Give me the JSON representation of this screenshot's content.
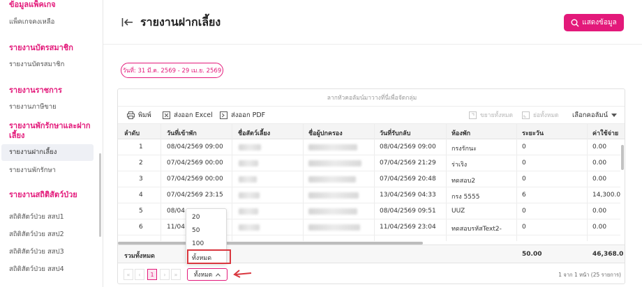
{
  "sidebar": {
    "sections": [
      {
        "title": "ข้อมูลแพ็คเกจ",
        "items": [
          "แพ็คเกจคงเหลือ"
        ]
      },
      {
        "title": "รายงานบัตรสมาชิก",
        "items": [
          "รายงานบัตรสมาชิก"
        ]
      },
      {
        "title": "รายงานราชการ",
        "items": [
          "รายงานภาษีขาย"
        ]
      },
      {
        "title": "รายงานพักรักษาและฝากเลี้ยง",
        "items": [
          "รายงานฝากเลี้ยง",
          "รายงานพักรักษา"
        ]
      },
      {
        "title": "รายงานสถิติสัตว์ป่วย",
        "items": [
          "สถิติสัตว์ป่วย สสป1",
          "สถิติสัตว์ป่วย สสป2",
          "สถิติสัตว์ป่วย สสป3",
          "สถิติสัตว์ป่วย สสป4"
        ]
      }
    ]
  },
  "header": {
    "title": "รายงานฝากเลี้ยง",
    "show_button": "แสดงข้อมูล"
  },
  "filter": {
    "date_range": "วันที่: 31 มี.ค. 2569 - 29 เม.ย. 2569"
  },
  "grid": {
    "group_hint": "ลากหัวคอลัมน์มาวางที่นี่เพื่อจัดกลุ่ม",
    "toolbar": {
      "print": "พิมพ์",
      "export_excel": "ส่งออก Excel",
      "export_pdf": "ส่งออก PDF",
      "expand_all": "ขยายทั้งหมด",
      "collapse_all": "ย่อทั้งหมด",
      "choose_columns": "เลือกคอลัมน์"
    },
    "columns": [
      "ลำดับ",
      "วันที่เข้าพัก",
      "ชื่อสัตว์เลี้ยง",
      "ชื่อผู้ปกครอง",
      "วันที่รับกลับ",
      "ห้องพัก",
      "ระยะวัน",
      "ค่าใช้จ่าย"
    ],
    "rows": [
      {
        "no": "1",
        "checkin": "08/04/2569 09:00",
        "checkout": "08/04/2569 09:00",
        "room": "กรงรักนะ",
        "days": "0",
        "cost": "0.00"
      },
      {
        "no": "2",
        "checkin": "07/04/2569 00:00",
        "checkout": "07/04/2569 21:29",
        "room": "ร่าเริง",
        "days": "0",
        "cost": "0.00"
      },
      {
        "no": "3",
        "checkin": "07/04/2569 00:00",
        "checkout": "07/04/2569 20:48",
        "room": "ทดสอบ2",
        "days": "0",
        "cost": "0.00"
      },
      {
        "no": "4",
        "checkin": "07/04/2569 23:15",
        "checkout": "13/04/2569 04:33",
        "room": "กรง 5555",
        "days": "6",
        "cost": "14,300.00"
      },
      {
        "no": "5",
        "checkin": "08/04",
        "checkout": "08/04/2569 09:51",
        "room": "UUZ",
        "days": "0",
        "cost": "0.00"
      },
      {
        "no": "6",
        "checkin": "11/04",
        "checkout": "11/04/2569 23:04",
        "room": "ทดสอบรหัสText2-",
        "days": "0",
        "cost": "0.00"
      }
    ],
    "footer": {
      "label": "รวมทั้งหมด",
      "days_total": "50.00",
      "cost_total": "46,368.0"
    },
    "pager": {
      "first": "«",
      "prev": "‹",
      "current_page": "1",
      "next": "›",
      "last": "»",
      "page_size": "ทั้งหมด",
      "info": "1 จาก 1 หน้า (25 รายการ)"
    },
    "page_size_options": [
      "20",
      "50",
      "100",
      "ทั้งหมด"
    ]
  },
  "colors": {
    "accent": "#e3197a",
    "highlight": "#d9363e"
  }
}
